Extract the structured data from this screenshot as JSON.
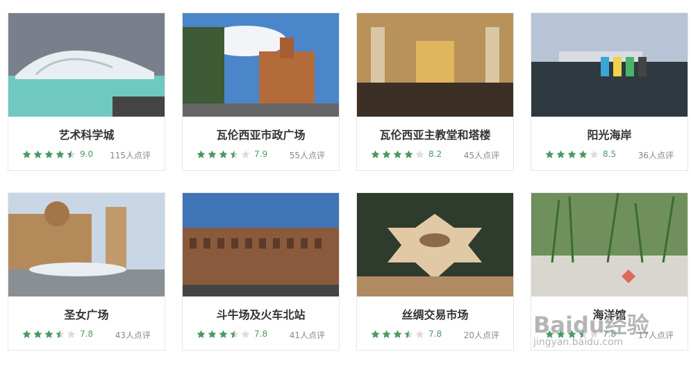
{
  "cards": [
    {
      "title": "艺术科学城",
      "score": "9.0",
      "reviews": "115人点评",
      "stars": 4.5,
      "icon": "science-city-image"
    },
    {
      "title": "瓦伦西亚市政广场",
      "score": "7.9",
      "reviews": "55人点评",
      "stars": 3.5,
      "icon": "city-hall-square-image"
    },
    {
      "title": "瓦伦西亚主教堂和塔楼",
      "score": "8.2",
      "reviews": "45人点评",
      "stars": 4.0,
      "icon": "cathedral-interior-image"
    },
    {
      "title": "阳光海岸",
      "score": "8.5",
      "reviews": "36人点评",
      "stars": 4.0,
      "icon": "sunny-beach-image"
    },
    {
      "title": "圣女广场",
      "score": "7.8",
      "reviews": "43人点评",
      "stars": 3.5,
      "icon": "virgin-square-image"
    },
    {
      "title": "斗牛场及火车北站",
      "score": "7.8",
      "reviews": "41人点评",
      "stars": 3.5,
      "icon": "bullring-station-image"
    },
    {
      "title": "丝绸交易市场",
      "score": "7.8",
      "reviews": "20人点评",
      "stars": 3.5,
      "icon": "silk-exchange-image"
    },
    {
      "title": "海洋馆",
      "score": "7.8",
      "reviews": "17人点评",
      "stars": 3.5,
      "icon": "aquarium-image"
    }
  ],
  "colors": {
    "star_on": "#4a9a62",
    "star_off": "#dddddd",
    "score": "#4a9a62"
  },
  "watermark": {
    "main": "Baidu经验",
    "sub": "jingyan.baidu.com"
  }
}
